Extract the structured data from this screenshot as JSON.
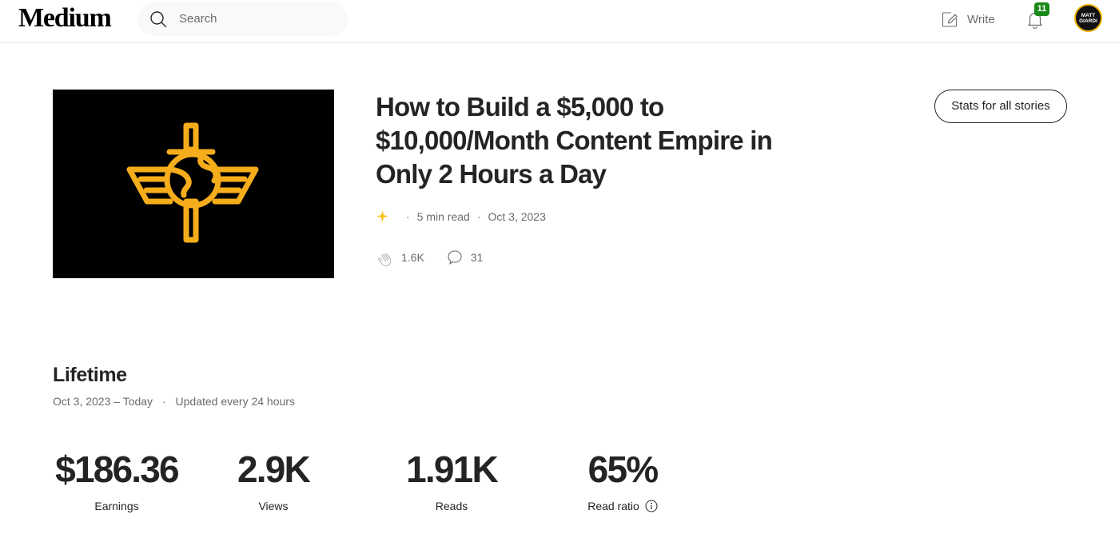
{
  "header": {
    "logo": "Medium",
    "search_placeholder": "Search",
    "write_label": "Write",
    "notification_count": "11",
    "avatar_text": "MATT GIARDI"
  },
  "story": {
    "title": "How to Build a $5,000 to $10,000/Month Content Empire in Only 2 Hours a Day",
    "read_time": "5 min read",
    "date": "Oct 3, 2023",
    "claps": "1.6K",
    "comments": "31",
    "stats_button": "Stats for all stories"
  },
  "lifetime": {
    "title": "Lifetime",
    "range": "Oct 3, 2023 – Today",
    "updated": "Updated every 24 hours",
    "metrics": [
      {
        "value": "$186.36",
        "label": "Earnings"
      },
      {
        "value": "2.9K",
        "label": "Views"
      },
      {
        "value": "1.91K",
        "label": "Reads"
      },
      {
        "value": "65%",
        "label": "Read ratio"
      }
    ]
  },
  "colors": {
    "accent_green": "#1a8917",
    "member_star": "#ffc017",
    "logo_gold": "#f6ad1b"
  },
  "icons": [
    "search-icon",
    "write-icon",
    "bell-icon",
    "star-icon",
    "clap-icon",
    "comment-icon",
    "info-icon"
  ]
}
